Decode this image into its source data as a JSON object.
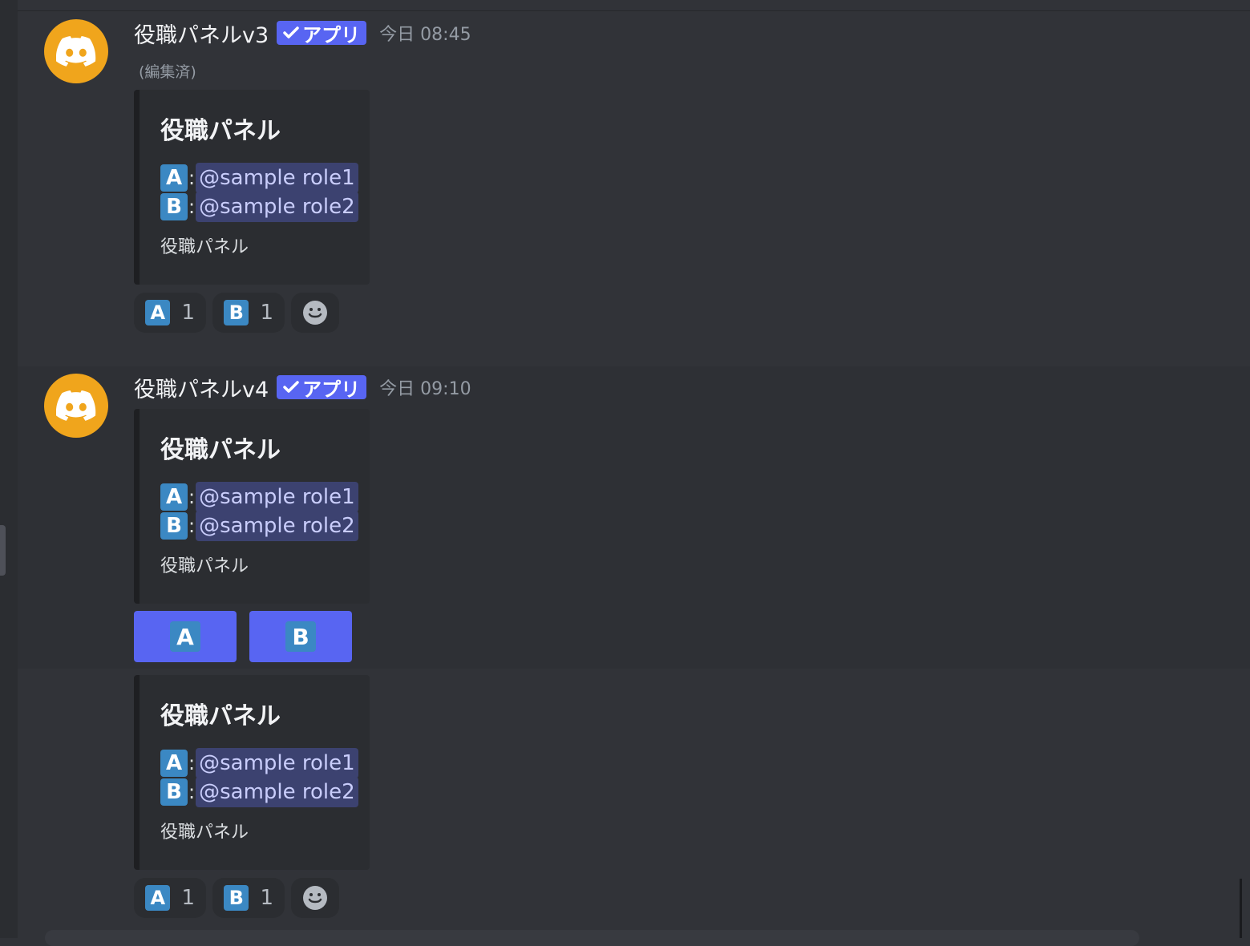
{
  "colors": {
    "background": "#313338",
    "embed_bg": "#2b2d31",
    "accent": "#5865f2",
    "avatar": "#f0a51c",
    "mention_bg": "#3c4270",
    "mention_text": "#c9cdfb",
    "emoji_keycap": "#3b88c3"
  },
  "messages": [
    {
      "avatar_icon": "discord-logo-icon",
      "username": "役職パネルv3",
      "app_tag": "アプリ",
      "timestamp": "今日 08:45",
      "edited": "(編集済)",
      "embed": {
        "title": "役職パネル",
        "roles": [
          {
            "emoji": "A",
            "colon": ":",
            "mention": "@sample role1"
          },
          {
            "emoji": "B",
            "colon": ":",
            "mention": "@sample role2"
          }
        ],
        "description": "役職パネル"
      },
      "reactions": [
        {
          "emoji": "A",
          "count": "1"
        },
        {
          "emoji": "B",
          "count": "1"
        }
      ],
      "add_reaction_icon": "smiley-add-reaction-icon"
    },
    {
      "avatar_icon": "discord-logo-icon",
      "username": "役職パネルv4",
      "app_tag": "アプリ",
      "timestamp": "今日 09:10",
      "embed": {
        "title": "役職パネル",
        "roles": [
          {
            "emoji": "A",
            "colon": ":",
            "mention": "@sample role1"
          },
          {
            "emoji": "B",
            "colon": ":",
            "mention": "@sample role2"
          }
        ],
        "description": "役職パネル"
      },
      "buttons": [
        {
          "emoji": "A"
        },
        {
          "emoji": "B"
        }
      ]
    },
    {
      "embed": {
        "title": "役職パネル",
        "roles": [
          {
            "emoji": "A",
            "colon": ":",
            "mention": "@sample role1"
          },
          {
            "emoji": "B",
            "colon": ":",
            "mention": "@sample role2"
          }
        ],
        "description": "役職パネル"
      },
      "reactions": [
        {
          "emoji": "A",
          "count": "1"
        },
        {
          "emoji": "B",
          "count": "1"
        }
      ],
      "add_reaction_icon": "smiley-add-reaction-icon"
    }
  ]
}
